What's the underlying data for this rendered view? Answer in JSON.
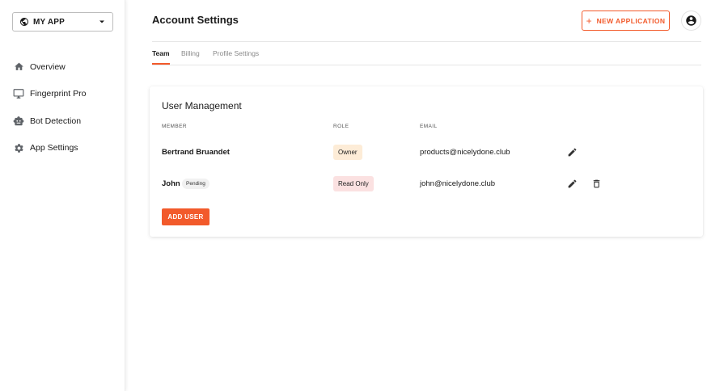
{
  "app_switcher": {
    "label": "MY APP",
    "icon": "globe-icon"
  },
  "sidebar": {
    "items": [
      {
        "label": "Overview",
        "icon": "home-icon"
      },
      {
        "label": "Fingerprint Pro",
        "icon": "monitor-icon"
      },
      {
        "label": "Bot Detection",
        "icon": "robot-icon"
      },
      {
        "label": "App Settings",
        "icon": "gear-icon"
      }
    ]
  },
  "header": {
    "title": "Account Settings",
    "new_app_label": "NEW APPLICATION",
    "account_icon": "account-circle-icon"
  },
  "tabs": [
    {
      "label": "Team",
      "active": true
    },
    {
      "label": "Billing",
      "active": false
    },
    {
      "label": "Profile Settings",
      "active": false
    }
  ],
  "card": {
    "title": "User Management",
    "columns": {
      "member": "MEMBER",
      "role": "ROLE",
      "email": "EMAIL"
    },
    "rows": [
      {
        "member": "Bertrand Bruandet",
        "badge": "",
        "role": "Owner",
        "email": "products@nicelydone.club",
        "actions": [
          "edit-icon"
        ]
      },
      {
        "member": "John",
        "badge": "Pending",
        "role": "Read Only",
        "email": "john@nicelydone.club",
        "actions": [
          "edit-icon",
          "delete-icon"
        ]
      }
    ],
    "add_user_label": "ADD USER"
  },
  "colors": {
    "accent": "#f25a2b",
    "owner_badge_bg": "#fdecd7",
    "readonly_badge_bg": "#fbe1e1",
    "pending_badge_bg": "#f1f1f1"
  }
}
